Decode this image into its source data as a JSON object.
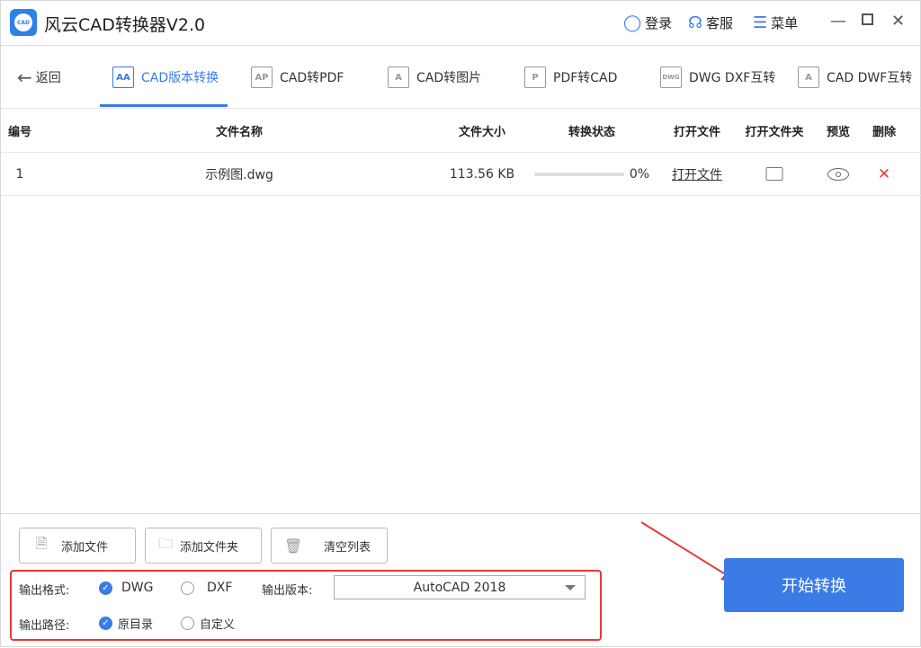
{
  "app": {
    "title": "风云CAD转换器V2.0",
    "logo_text": "CAD"
  },
  "topbar": {
    "login": "登录",
    "service": "客服",
    "menu": "菜单"
  },
  "nav": {
    "back": "返回",
    "tabs": [
      {
        "label": "CAD版本转换",
        "icon": "A A"
      },
      {
        "label": "CAD转PDF",
        "icon": "A P"
      },
      {
        "label": "CAD转图片",
        "icon": "A"
      },
      {
        "label": "PDF转CAD",
        "icon": "P"
      },
      {
        "label": "DWG DXF互转",
        "icon": "DWG"
      },
      {
        "label": "CAD DWF互转",
        "icon": "A"
      }
    ],
    "active": 0
  },
  "table": {
    "headers": [
      "编号",
      "文件名称",
      "文件大小",
      "转换状态",
      "打开文件",
      "打开文件夹",
      "预览",
      "删除"
    ],
    "rows": [
      {
        "index": "1",
        "name": "示例图.dwg",
        "size": "113.56 KB",
        "progress": "0%",
        "open_file": "打开文件"
      }
    ]
  },
  "buttons": {
    "add_file": "添加文件",
    "add_folder": "添加文件夹",
    "clear": "清空列表",
    "start": "开始转换"
  },
  "options": {
    "format_label": "输出格式:",
    "format_dwg": "DWG",
    "format_dxf": "DXF",
    "format_selected": "DWG",
    "version_label": "输出版本:",
    "version_value": "AutoCAD 2018",
    "path_label": "输出路径:",
    "path_original": "原目录",
    "path_custom": "自定义",
    "path_selected": "原目录"
  },
  "colors": {
    "accent": "#3a7be6",
    "annotation": "#e53935",
    "delete": "#e53935"
  }
}
